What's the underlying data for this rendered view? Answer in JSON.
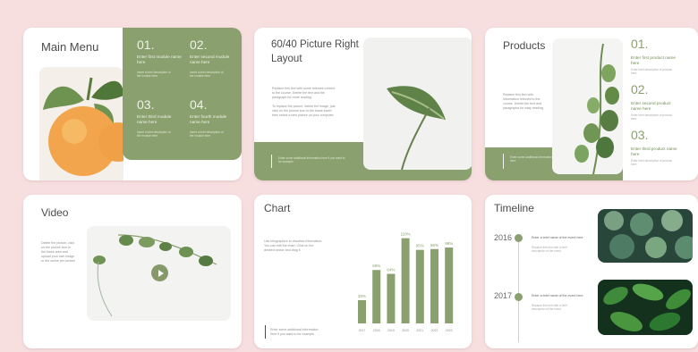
{
  "slides": {
    "main_menu": {
      "title": "Main Menu",
      "items": [
        {
          "number": "01.",
          "label": "Enter first module name here",
          "desc": "Insert a brief description of the module here"
        },
        {
          "number": "02.",
          "label": "Enter second module name here",
          "desc": "Insert a brief description of the module here"
        },
        {
          "number": "03.",
          "label": "Enter third module name here",
          "desc": "Insert a brief description of the module here"
        },
        {
          "number": "04.",
          "label": "Enter fourth module name here",
          "desc": "Insert a brief description of the module here"
        }
      ]
    },
    "picture_layout": {
      "title_line1": "60/40 Picture Right",
      "title_line2": "Layout",
      "body1": "Replace this text with some relevant content to the course. Delete the text and the paragraph for more reading.",
      "body2": "To replace the picture, delete the image, just click on the picture icon in the blank insert, then select a new picture on your computer.",
      "footer": "Enter some additional information here if you want to for example"
    },
    "products": {
      "title": "Products",
      "body": "Replace this text with information relevant to the course. Delete the text and paragraphs for easy reading.",
      "footer": "Enter some additional information here",
      "items": [
        {
          "number": "01.",
          "label": "Enter first product name here",
          "desc": "Enter brief description of product here"
        },
        {
          "number": "02.",
          "label": "Enter second product name here",
          "desc": "Enter brief description of product here"
        },
        {
          "number": "03.",
          "label": "Enter third product name here",
          "desc": "Enter brief description of product here"
        }
      ]
    },
    "video": {
      "title": "Video",
      "body": "Delete the picture, click on the picture icon in the blank area and upload your own image or the online per screen"
    },
    "chart": {
      "title": "Chart",
      "body": "Use infographics to visualize information. You can edit the chart. Click on the desired sector and drag it.",
      "footer": "Enter some additional information here if you want to for example"
    },
    "timeline": {
      "title": "Timeline",
      "entries": [
        {
          "year": "2016",
          "label": "Enter a brief name of the event here",
          "desc": "Replace this text with a brief description of the event."
        },
        {
          "year": "2017",
          "label": "Enter a brief name of the event here",
          "desc": "Replace this text with a brief description of the event."
        }
      ]
    }
  },
  "chart_data": {
    "type": "bar",
    "categories": [
      "2017",
      "2018",
      "2019",
      "2020",
      "2021",
      "2022",
      "2023"
    ],
    "values": [
      30,
      69,
      64,
      110,
      95,
      96,
      98
    ],
    "labels": [
      "30%",
      "69%",
      "64%",
      "110%",
      "95%",
      "96%",
      "98%"
    ],
    "ylim": [
      0,
      120
    ],
    "grid": false,
    "bar_color": "#8aa06e"
  },
  "colors": {
    "background": "#f7dfe0",
    "accent": "#8aa06e",
    "text": "#4b4b4b"
  }
}
